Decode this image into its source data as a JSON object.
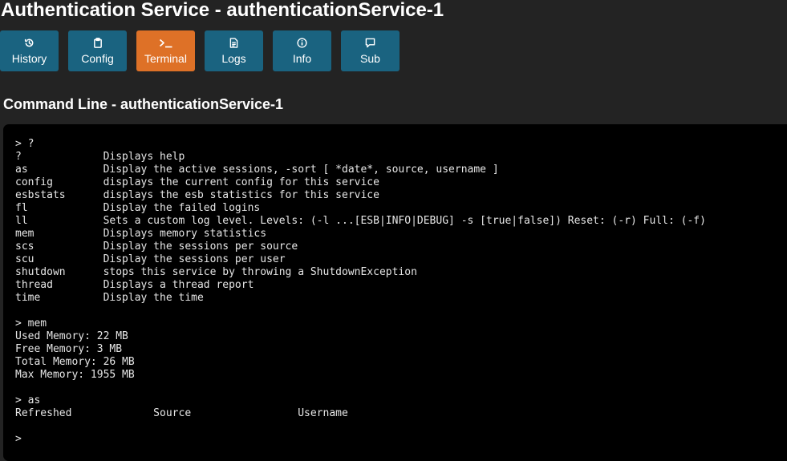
{
  "page": {
    "title": "Authentication Service - authenticationService-1"
  },
  "toolbar": {
    "buttons": [
      {
        "label": "History",
        "icon": "history-icon",
        "active": false
      },
      {
        "label": "Config",
        "icon": "clipboard-icon",
        "active": false
      },
      {
        "label": "Terminal",
        "icon": "terminal-icon",
        "active": true
      },
      {
        "label": "Logs",
        "icon": "file-icon",
        "active": false
      },
      {
        "label": "Info",
        "icon": "info-icon",
        "active": false
      },
      {
        "label": "Sub",
        "icon": "message-icon",
        "active": false
      }
    ]
  },
  "section": {
    "title": "Command Line - authenticationService-1"
  },
  "terminal": {
    "output": "> ?\n?             Displays help\nas            Display the active sessions, -sort [ *date*, source, username ]\nconfig        displays the current config for this service\nesbstats      displays the esb statistics for this service\nfl            Display the failed logins\nll            Sets a custom log level. Levels: (-l ...[ESB|INFO|DEBUG] -s [true|false]) Reset: (-r) Full: (-f)\nmem           Displays memory statistics\nscs           Display the sessions per source\nscu           Display the sessions per user\nshutdown      stops this service by throwing a ShutdownException\nthread        Displays a thread report\ntime          Display the time\n\n> mem\nUsed Memory: 22 MB\nFree Memory: 3 MB\nTotal Memory: 26 MB\nMax Memory: 1955 MB\n\n> as\nRefreshed             Source                 Username\n\n>"
  },
  "colors": {
    "background": "#232323",
    "button": "#1a6380",
    "button_active": "#de7127",
    "terminal_bg": "#000000",
    "terminal_text": "#e6e6e6"
  }
}
